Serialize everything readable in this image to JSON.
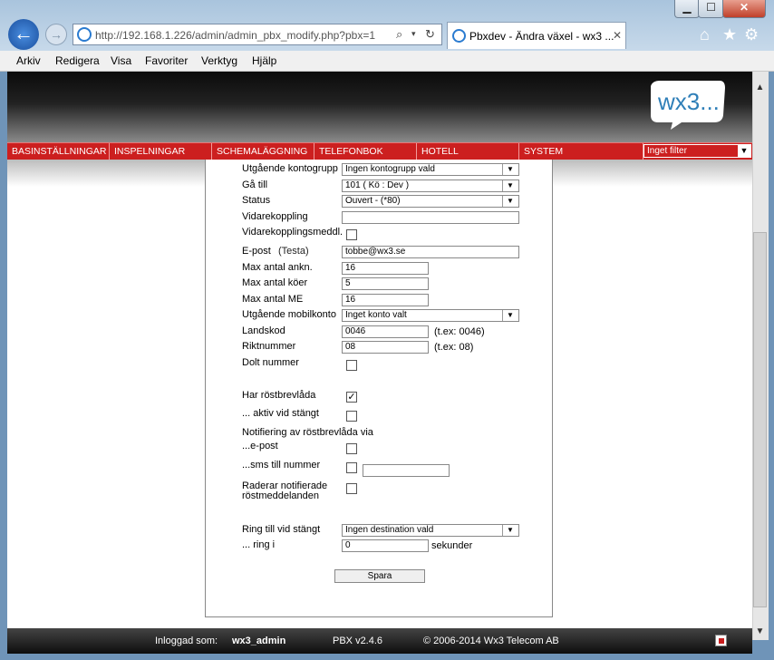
{
  "window": {
    "minimize": "▁",
    "maximize": "☐",
    "close": "✕"
  },
  "browser": {
    "address": "http://192.168.1.226/admin/admin_pbx_modify.php?pbx=1",
    "tab_title": "Pbxdev - Ändra växel - wx3 ...",
    "tab_close": "✕",
    "menu": [
      "Arkiv",
      "Redigera",
      "Visa",
      "Favoriter",
      "Verktyg",
      "Hjälp"
    ]
  },
  "site": {
    "logo_text": "wx3...",
    "nav": [
      "BASINSTÄLLNINGAR",
      "INSPELNINGAR",
      "SCHEMALÄGGNING",
      "TELEFONBOK",
      "HOTELL",
      "SYSTEM"
    ],
    "filter": "Inget filter"
  },
  "form": {
    "kontogrupp": {
      "label": "Utgående kontogrupp",
      "value": "Ingen kontogrupp vald"
    },
    "gatill": {
      "label": "Gå till",
      "value": "101 ( Kö : Dev )"
    },
    "status": {
      "label": "Status",
      "value": "Ouvert - (*80)"
    },
    "vidarekoppling": {
      "label": "Vidarekoppling",
      "value": ""
    },
    "vidarekopplingsmeddl": {
      "label": "Vidarekopplingsmeddl.",
      "checked": false
    },
    "epost": {
      "label": "E-post",
      "link": "(Testa)",
      "value": "tobbe@wx3.se"
    },
    "max_ankn": {
      "label": "Max antal ankn.",
      "value": "16"
    },
    "max_koer": {
      "label": "Max antal köer",
      "value": "5"
    },
    "max_me": {
      "label": "Max antal ME",
      "value": "16"
    },
    "mobilkonto": {
      "label": "Utgående mobilkonto",
      "value": "Inget konto valt"
    },
    "landskod": {
      "label": "Landskod",
      "value": "0046",
      "hint": "(t.ex: 0046)"
    },
    "riktnummer": {
      "label": "Riktnummer",
      "value": "08",
      "hint": "(t.ex: 08)"
    },
    "dolt": {
      "label": "Dolt nummer",
      "checked": false
    },
    "rostbrevlada": {
      "label": "Har röstbrevlåda",
      "checked": true
    },
    "aktiv_stangt": {
      "label": "... aktiv vid stängt",
      "checked": false
    },
    "notifiering": {
      "label": "Notifiering av röstbrevlåda via"
    },
    "notif_epost": {
      "label": "...e-post",
      "checked": false
    },
    "notif_sms": {
      "label": "...sms till nummer",
      "checked": false,
      "value": ""
    },
    "raderar": {
      "label1": "Raderar notifierade",
      "label2": "röstmeddelanden",
      "checked": false
    },
    "ring_stangt": {
      "label": "Ring till vid stängt",
      "value": "Ingen destination vald"
    },
    "ring_i": {
      "label": "... ring i",
      "value": "0",
      "unit": "sekunder"
    },
    "save": "Spara"
  },
  "footer": {
    "logged_label": "Inloggad som:",
    "user": "wx3_admin",
    "version": "PBX v2.4.6",
    "copyright": "© 2006-2014 Wx3 Telecom AB"
  },
  "colors": {
    "nav": "#cc1f1f",
    "banner": "#111111"
  }
}
